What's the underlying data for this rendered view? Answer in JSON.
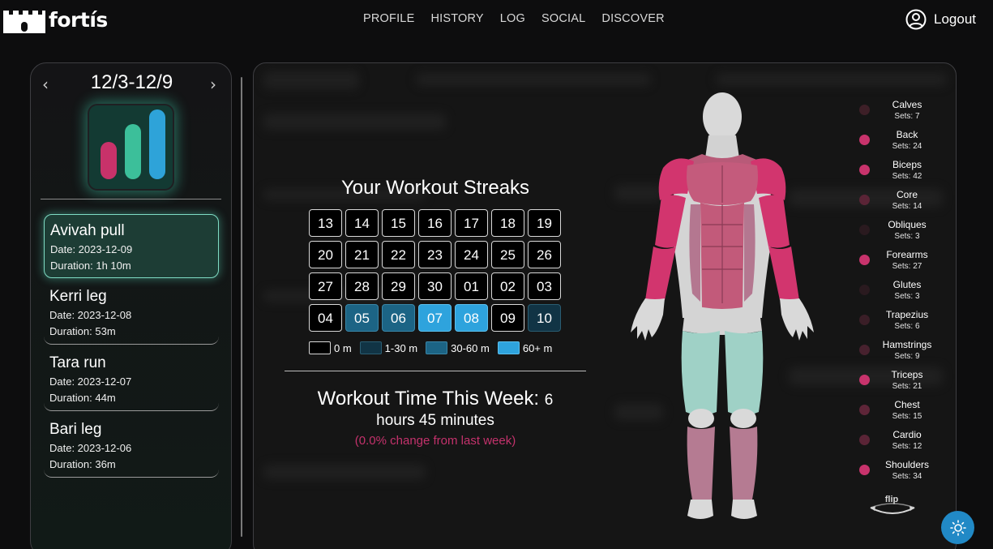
{
  "brand": {
    "name": "fortís"
  },
  "nav": [
    {
      "label": "PROFILE"
    },
    {
      "label": "HISTORY"
    },
    {
      "label": "LOG"
    },
    {
      "label": "SOCIAL"
    },
    {
      "label": "DISCOVER"
    }
  ],
  "account": {
    "logout_label": "Logout",
    "icon": "user-circle-icon"
  },
  "week": {
    "prev_icon": "chevron-left-icon",
    "label": "12/3-12/9",
    "next_icon": "chevron-right-icon"
  },
  "workouts": [
    {
      "title": "Avivah pull",
      "date": "Date: 2023-12-09",
      "duration": "Duration: 1h 10m",
      "selected": true
    },
    {
      "title": "Kerri leg",
      "date": "Date: 2023-12-08",
      "duration": "Duration: 53m",
      "selected": false
    },
    {
      "title": "Tara run",
      "date": "Date: 2023-12-07",
      "duration": "Duration: 44m",
      "selected": false
    },
    {
      "title": "Bari leg",
      "date": "Date: 2023-12-06",
      "duration": "Duration: 36m",
      "selected": false
    }
  ],
  "streaks": {
    "title": "Your Workout Streaks",
    "days": [
      {
        "day": "13",
        "level": 0
      },
      {
        "day": "14",
        "level": 0
      },
      {
        "day": "15",
        "level": 0
      },
      {
        "day": "16",
        "level": 0
      },
      {
        "day": "17",
        "level": 0
      },
      {
        "day": "18",
        "level": 0
      },
      {
        "day": "19",
        "level": 0
      },
      {
        "day": "20",
        "level": 0
      },
      {
        "day": "21",
        "level": 0
      },
      {
        "day": "22",
        "level": 0
      },
      {
        "day": "23",
        "level": 0
      },
      {
        "day": "24",
        "level": 0
      },
      {
        "day": "25",
        "level": 0
      },
      {
        "day": "26",
        "level": 0
      },
      {
        "day": "27",
        "level": 0
      },
      {
        "day": "28",
        "level": 0
      },
      {
        "day": "29",
        "level": 0
      },
      {
        "day": "30",
        "level": 0
      },
      {
        "day": "01",
        "level": 0
      },
      {
        "day": "02",
        "level": 0
      },
      {
        "day": "03",
        "level": 0
      },
      {
        "day": "04",
        "level": 0
      },
      {
        "day": "05",
        "level": 2
      },
      {
        "day": "06",
        "level": 2
      },
      {
        "day": "07",
        "level": 3
      },
      {
        "day": "08",
        "level": 3
      },
      {
        "day": "09",
        "level": 0
      },
      {
        "day": "10",
        "level": 1
      }
    ],
    "legend": [
      {
        "label": "0 m",
        "color": "#000000"
      },
      {
        "label": "1-30 m",
        "color": "#113445"
      },
      {
        "label": "30-60 m",
        "color": "#1c6485"
      },
      {
        "label": "60+ m",
        "color": "#2ea3dd"
      }
    ]
  },
  "weekly_time": {
    "title": "Workout Time This Week:",
    "hours": "6",
    "rest": "hours 45 minutes",
    "change": "(0.0% change from last week)"
  },
  "muscles": [
    {
      "name": "Calves",
      "sets": "Sets: 7",
      "color": "#3d1f27"
    },
    {
      "name": "Back",
      "sets": "Sets: 24",
      "color": "#c8336c"
    },
    {
      "name": "Biceps",
      "sets": "Sets: 42",
      "color": "#c8336c"
    },
    {
      "name": "Core",
      "sets": "Sets: 14",
      "color": "#5a2436"
    },
    {
      "name": "Obliques",
      "sets": "Sets: 3",
      "color": "#2a1a1f"
    },
    {
      "name": "Forearms",
      "sets": "Sets: 27",
      "color": "#c8336c"
    },
    {
      "name": "Glutes",
      "sets": "Sets: 3",
      "color": "#2a1a1f"
    },
    {
      "name": "Trapezius",
      "sets": "Sets: 6",
      "color": "#3a1e27"
    },
    {
      "name": "Hamstrings",
      "sets": "Sets: 9",
      "color": "#47212e"
    },
    {
      "name": "Triceps",
      "sets": "Sets: 21",
      "color": "#c8336c"
    },
    {
      "name": "Chest",
      "sets": "Sets: 15",
      "color": "#5e2538"
    },
    {
      "name": "Cardio",
      "sets": "Sets: 12",
      "color": "#5a2436"
    },
    {
      "name": "Shoulders",
      "sets": "Sets: 34",
      "color": "#c8336c"
    }
  ],
  "flip": {
    "label": "flip",
    "icon": "rotate-arrows-icon"
  },
  "theme_toggle": {
    "icon": "sun-icon"
  },
  "colors": {
    "accent": "#2ea3dd",
    "highlight": "#c8336c",
    "mint": "#3cbf9a"
  }
}
